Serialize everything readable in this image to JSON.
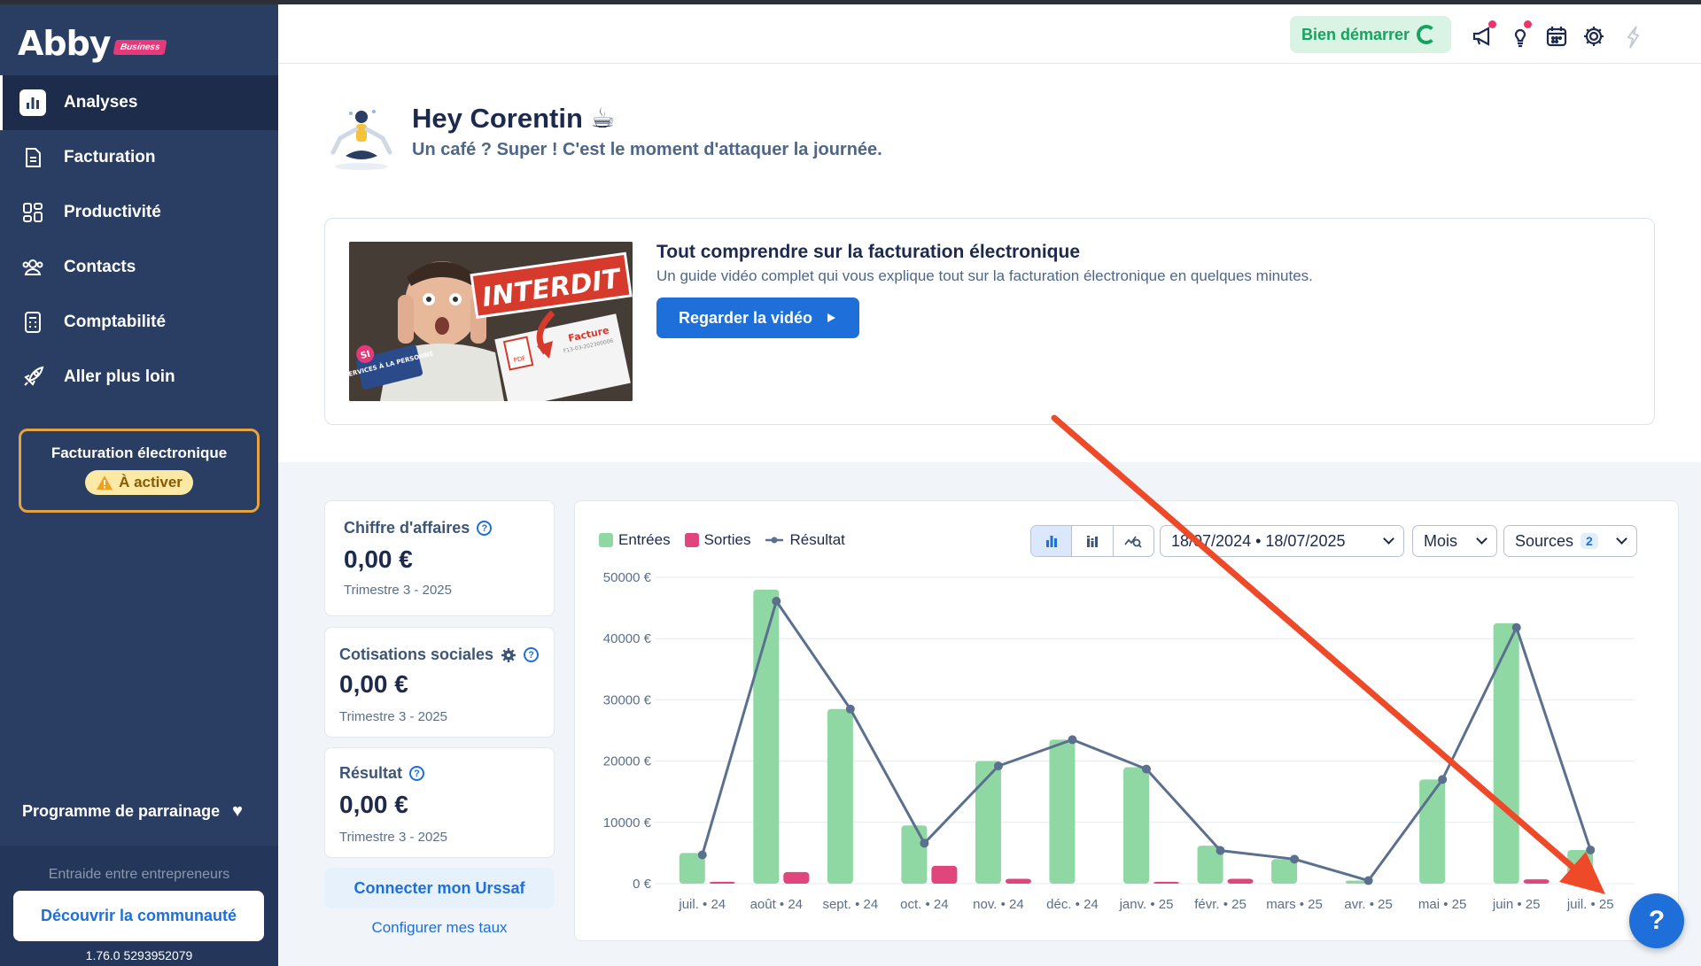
{
  "sidebar": {
    "logo": "Abby",
    "logo_badge": "Business",
    "nav": [
      {
        "label": "Analyses",
        "active": true
      },
      {
        "label": "Facturation"
      },
      {
        "label": "Productivité"
      },
      {
        "label": "Contacts"
      },
      {
        "label": "Comptabilité"
      },
      {
        "label": "Aller plus loin"
      }
    ],
    "efact_title": "Facturation électronique",
    "efact_status": "À activer",
    "parrainage": "Programme de parrainage",
    "entraide": "Entraide entre entrepreneurs",
    "community_btn": "Découvrir la communauté",
    "version": "1.76.0 5293952079"
  },
  "topbar": {
    "start_label": "Bien démarrer"
  },
  "greeting": {
    "title": "Hey Corentin ☕",
    "subtitle": "Un café ? Super ! C'est le moment d'attaquer la journée."
  },
  "video": {
    "title": "Tout comprendre sur la facturation électronique",
    "subtitle": "Un guide vidéo complet qui vous explique tout sur la facturation électronique en quelques minutes.",
    "button": "Regarder la vidéo",
    "thumb_banner": "INTERDIT",
    "thumb_badge_si": "SI",
    "thumb_badge_text": "SERVICES À LA PERSONNE",
    "thumb_doc": "Facture",
    "thumb_doc_ref": "F13-03-202300006",
    "thumb_pdf": "PDF"
  },
  "kpis": [
    {
      "title": "Chiffre d'affaires",
      "value": "0,00 €",
      "period": "Trimestre 3 - 2025"
    },
    {
      "title": "Cotisations sociales",
      "value": "0,00 €",
      "period": "Trimestre 3 - 2025"
    },
    {
      "title": "Résultat",
      "value": "0,00 €",
      "period": "Trimestre 3 - 2025"
    }
  ],
  "urssaf_btn": "Connecter mon Urssaf",
  "config_link": "Configurer mes taux",
  "chart_controls": {
    "date_range": "18/07/2024 • 18/07/2025",
    "period": "Mois",
    "sources_label": "Sources",
    "sources_count": "2"
  },
  "help_label": "?",
  "colors": {
    "entrees": "#8fd8a4",
    "sorties": "#e0457b",
    "resultat": "#5b6f8e",
    "primary": "#1e6fd9",
    "sidebar": "#2a3d63",
    "annotation_arrow": "#ee4a2a"
  },
  "chart_data": {
    "type": "bar",
    "categories": [
      "juil. • 24",
      "août • 24",
      "sept. • 24",
      "oct. • 24",
      "nov. • 24",
      "déc. • 24",
      "janv. • 25",
      "févr. • 25",
      "mars • 25",
      "avr. • 25",
      "mai • 25",
      "juin • 25",
      "juil. • 25"
    ],
    "series": [
      {
        "name": "Entrées",
        "type": "bar",
        "values": [
          5000,
          48000,
          28500,
          9500,
          20000,
          23500,
          19000,
          6200,
          4000,
          500,
          17000,
          42500,
          5500
        ]
      },
      {
        "name": "Sorties",
        "type": "bar",
        "values": [
          300,
          1900,
          0,
          2900,
          800,
          0,
          300,
          800,
          0,
          0,
          0,
          700,
          0
        ]
      },
      {
        "name": "Résultat",
        "type": "line",
        "values": [
          4700,
          46100,
          28500,
          6600,
          19200,
          23500,
          18700,
          5400,
          4000,
          500,
          17000,
          41800,
          5500
        ]
      }
    ],
    "y_ticks": [
      "0 €",
      "10000 €",
      "20000 €",
      "30000 €",
      "40000 €",
      "50000 €"
    ],
    "ylim": [
      0,
      50000
    ],
    "grid": true,
    "legend": "top-left"
  }
}
